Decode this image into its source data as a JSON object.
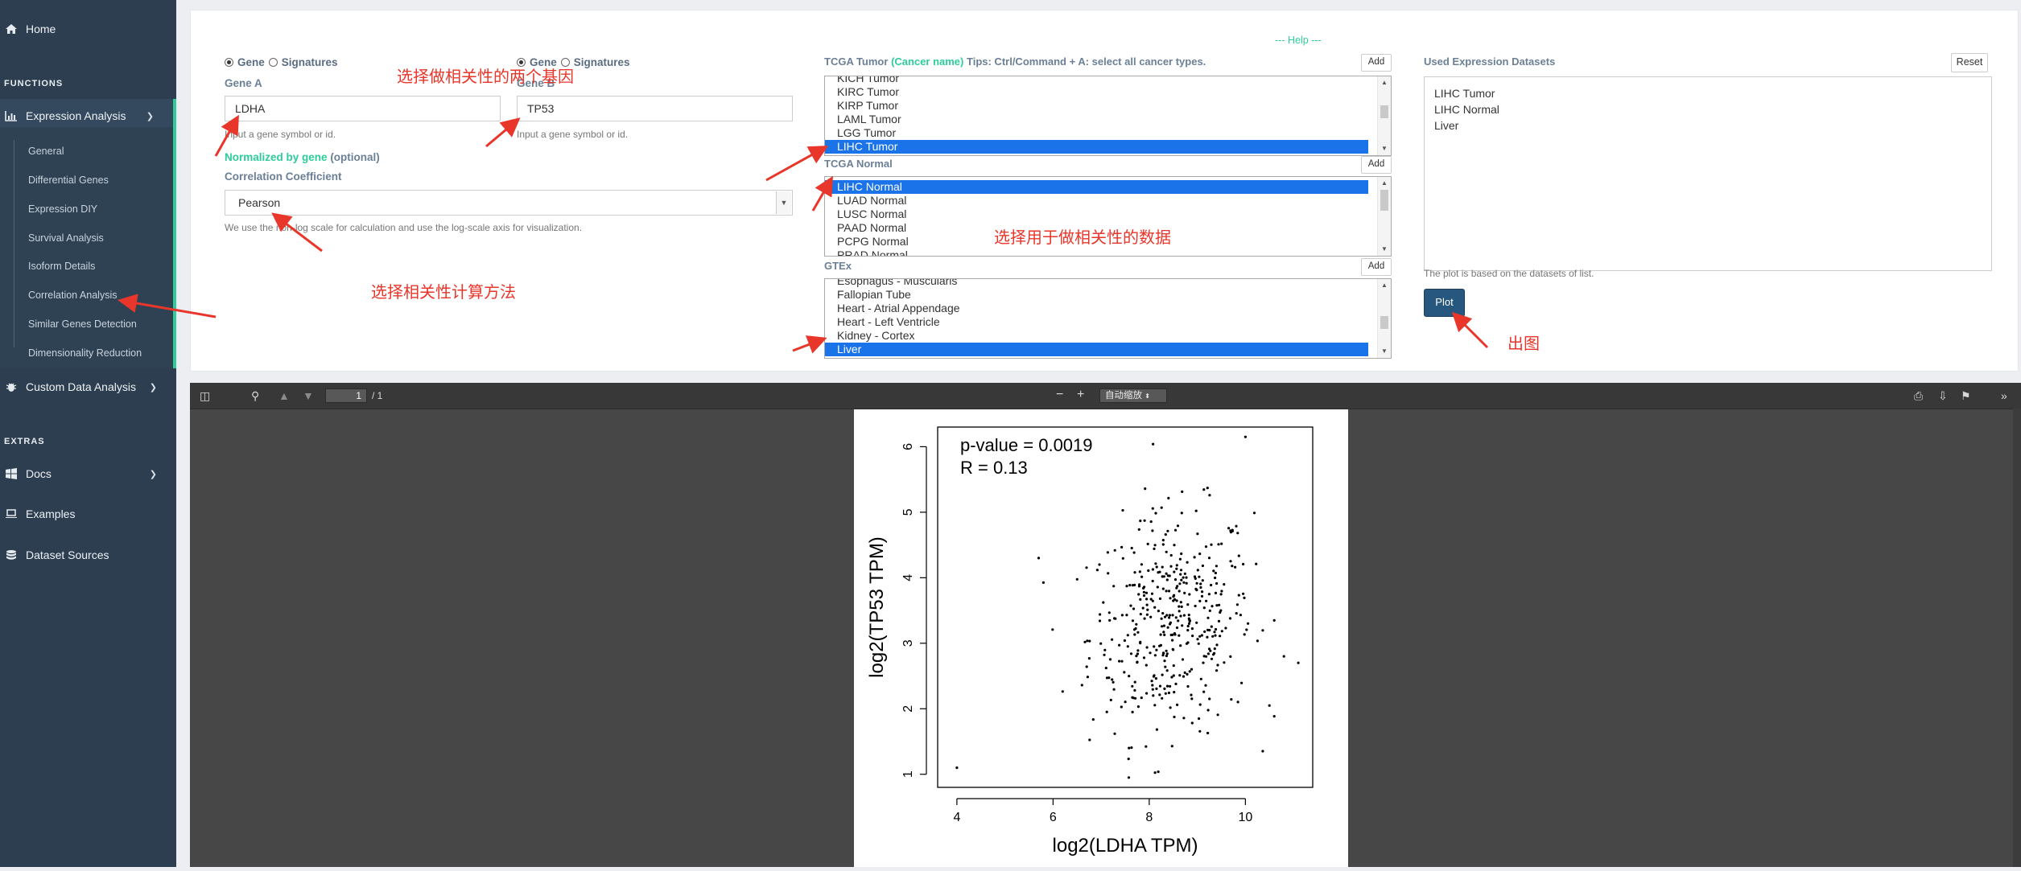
{
  "sidebar": {
    "home": "Home",
    "functions_label": "FUNCTIONS",
    "expression_analysis": "Expression Analysis",
    "sub_items": [
      "General",
      "Differential Genes",
      "Expression DIY",
      "Survival Analysis",
      "Isoform Details",
      "Correlation Analysis",
      "Similar Genes Detection",
      "Dimensionality Reduction"
    ],
    "custom_data_analysis": "Custom Data Analysis",
    "extras_label": "EXTRAS",
    "docs": "Docs",
    "examples": "Examples",
    "dataset_sources": "Dataset Sources"
  },
  "form": {
    "help": "--- Help ---",
    "radio_gene": "Gene",
    "radio_signatures": "Signatures",
    "gene_a_label": "Gene A",
    "gene_a_value": "LDHA",
    "gene_a_hint": "Input a gene symbol or id.",
    "gene_b_label": "Gene B",
    "gene_b_value": "TP53",
    "gene_b_hint": "Input a gene symbol or id.",
    "normalized_by_gene": "Normalized by gene",
    "optional": "(optional)",
    "correlation_label": "Correlation Coefficient",
    "correlation_value": "Pearson",
    "correlation_hint": "We use the non-log scale for calculation and use the log-scale axis for visualization."
  },
  "datasets": {
    "tumor_title_prefix": "TCGA Tumor",
    "tumor_title_paren": "(Cancer name)",
    "tumor_title_tip": "Tips: Ctrl/Command + A: select all cancer types.",
    "add": "Add",
    "tumor_items": [
      "KICH Tumor",
      "KIRC Tumor",
      "KIRP Tumor",
      "LAML Tumor",
      "LGG Tumor",
      "LIHC Tumor"
    ],
    "normal_title": "TCGA Normal",
    "normal_items": [
      "LIHC Normal",
      "LUAD Normal",
      "LUSC Normal",
      "PAAD Normal",
      "PCPG Normal",
      "PRAD Normal"
    ],
    "gtex_title": "GTEx",
    "gtex_items": [
      "Esophagus - Muscularis",
      "Fallopian Tube",
      "Heart - Atrial Appendage",
      "Heart - Left Ventricle",
      "Kidney - Cortex",
      "Liver"
    ],
    "used_title": "Used Expression Datasets",
    "reset": "Reset",
    "used_items": [
      "LIHC Tumor",
      "LIHC Normal",
      "Liver"
    ],
    "used_hint": "The plot is based on the datasets of list.",
    "plot": "Plot"
  },
  "annotations": {
    "genes": "选择做相关性的两个基因",
    "data": "选择用于做相关性的数据",
    "method": "选择相关性计算方法",
    "plot": "出图"
  },
  "viewer": {
    "page": "1",
    "total": "/ 1",
    "zoom": "自动缩放"
  },
  "chart_data": {
    "type": "scatter",
    "annotations": [
      "p-value = 0.0019",
      "R = 0.13"
    ],
    "xlabel": "log2(LDHA TPM)",
    "ylabel": "log2(TP53 TPM)",
    "xlim": [
      3.6,
      11.4
    ],
    "ylim": [
      0.8,
      6.3
    ],
    "xticks": [
      4,
      6,
      8,
      10
    ],
    "yticks": [
      1,
      2,
      3,
      4,
      5,
      6
    ],
    "points_approx": "about 420 points: main cloud x 6-10.5 centered near 8.5, y 1-6 centered near 3.3; outliers at (4.0,1.1), (5.7,4.3), (10.8,2.8), (11.1,2.7)"
  }
}
